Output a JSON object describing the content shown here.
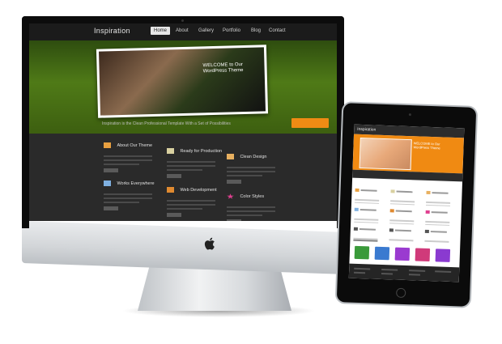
{
  "imac": {
    "site": {
      "logo": "Inspiration",
      "nav": [
        "Home",
        "About",
        "Gallery",
        "Portfolio",
        "Blog",
        "Contact"
      ],
      "hero_heading": [
        "WELCOME to Our",
        "WordPress Theme"
      ],
      "tagline": "Inspiration is the Clean Professional Template With a Set of Possibilities",
      "cta_label": "",
      "features": [
        {
          "title": "About Our Theme",
          "icon": "folder-icon",
          "color": "#e8a040"
        },
        {
          "title": "Ready for Production",
          "icon": "document-icon",
          "color": "#d8d0a0"
        },
        {
          "title": "Clean Design",
          "icon": "folder-icon",
          "color": "#e8b060"
        },
        {
          "title": "Works Everywhere",
          "icon": "monitor-icon",
          "color": "#7fb0e0"
        },
        {
          "title": "Web Development",
          "icon": "folder-icon",
          "color": "#e08a30"
        },
        {
          "title": "Color Styles",
          "icon": "star-icon",
          "color": "#e04090"
        }
      ]
    }
  },
  "ipad": {
    "site": {
      "logo": "Inspiration",
      "hero_heading": [
        "WELCOME to Our",
        "WordPress Theme"
      ],
      "gallery_colors": [
        "#3a9a3a",
        "#3a7ad0",
        "#9a3ad0",
        "#d03a7a",
        "#8a3ad0"
      ]
    }
  },
  "colors": {
    "accent": "#ef8b14",
    "hero_green": "#4f7a17",
    "screen_dark": "#2a2a2a"
  }
}
